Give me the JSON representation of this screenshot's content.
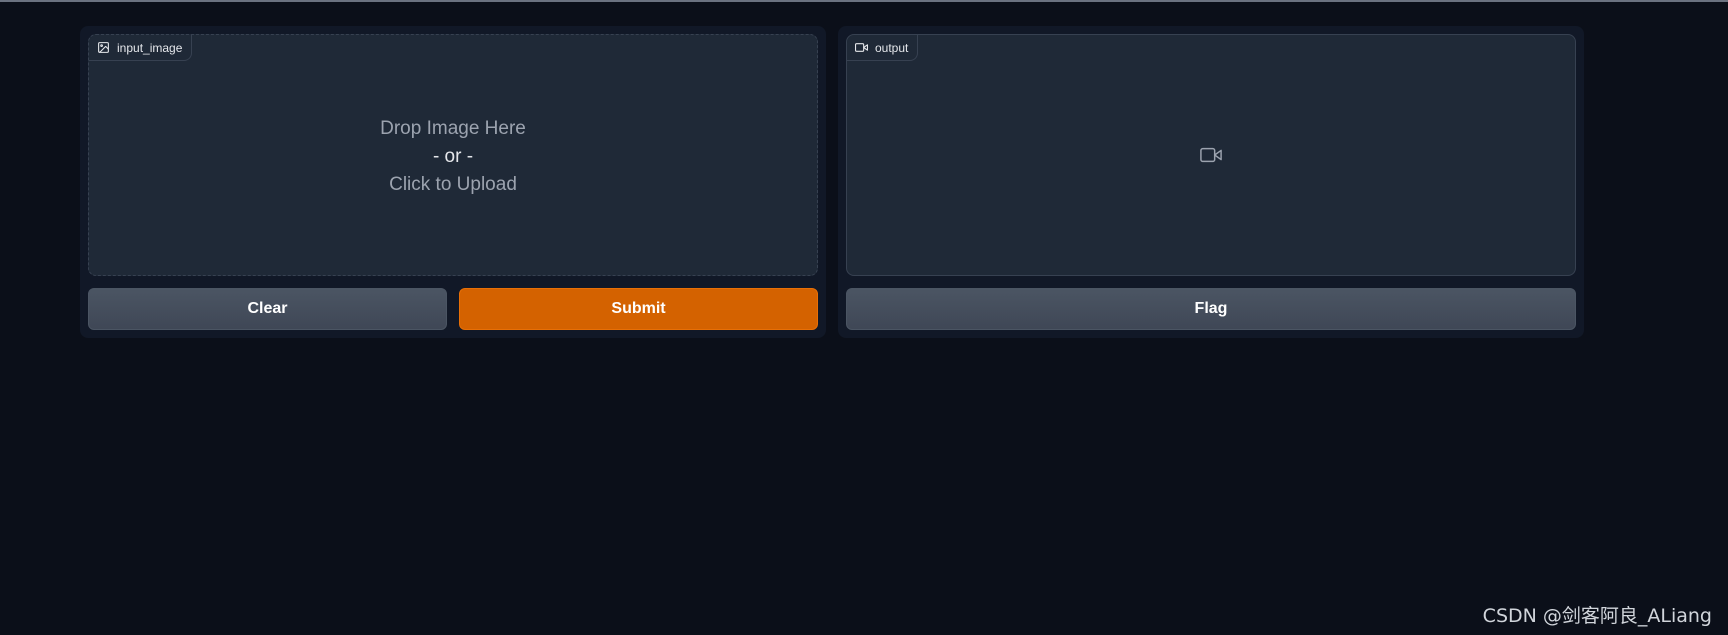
{
  "input": {
    "label": "input_image",
    "drop_line1": "Drop Image Here",
    "drop_line2": "- or -",
    "drop_line3": "Click to Upload",
    "icon": "image-icon"
  },
  "output": {
    "label": "output",
    "icon": "video-icon"
  },
  "buttons": {
    "clear": "Clear",
    "submit": "Submit",
    "flag": "Flag"
  },
  "watermark": "CSDN @剑客阿良_ALiang",
  "colors": {
    "background": "#0b0f19",
    "panel": "#111827",
    "box": "#1f2937",
    "primary": "#d46200",
    "secondary": "#4b5563"
  }
}
